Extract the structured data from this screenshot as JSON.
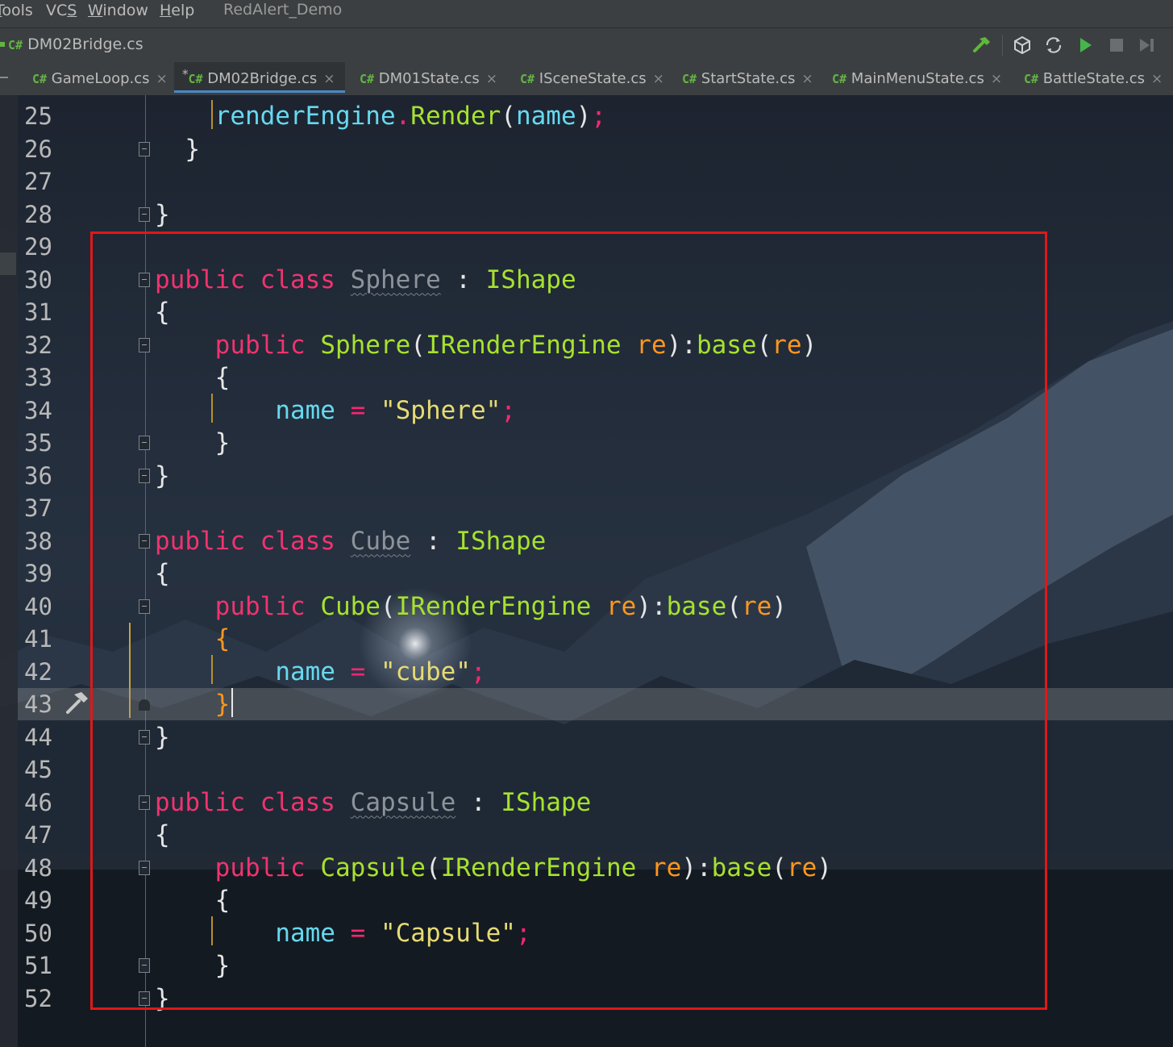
{
  "menubar": {
    "items": [
      {
        "label": "Tools",
        "underline": "T"
      },
      {
        "label": "VCS",
        "underline": "S"
      },
      {
        "label": "Window",
        "underline": "W"
      },
      {
        "label": "Help",
        "underline": "H"
      }
    ],
    "project": "RedAlert_Demo"
  },
  "navbar": {
    "breadcrumb_lang": "C#",
    "breadcrumb_file": "DM02Bridge.cs",
    "toolbar_icons": [
      "hammer-build-icon",
      "unity-icon",
      "refresh-sync-icon",
      "run-icon",
      "stop-icon",
      "step-icon"
    ]
  },
  "tabs": [
    {
      "lang": "C#",
      "label": "GameLoop.cs",
      "modified": false,
      "active": false
    },
    {
      "lang": "C#",
      "label": "DM02Bridge.cs",
      "modified": true,
      "active": true
    },
    {
      "lang": "C#",
      "label": "DM01State.cs",
      "modified": false,
      "active": false
    },
    {
      "lang": "C#",
      "label": "ISceneState.cs",
      "modified": false,
      "active": false
    },
    {
      "lang": "C#",
      "label": "StartState.cs",
      "modified": false,
      "active": false
    },
    {
      "lang": "C#",
      "label": "MainMenuState.cs",
      "modified": false,
      "active": false
    },
    {
      "lang": "C#",
      "label": "BattleState.cs",
      "modified": false,
      "active": false
    }
  ],
  "tab_close_glyph": "×",
  "tab_modified_glyph": "*",
  "editor": {
    "current_line": 43,
    "highlight_region": "lines 29-52",
    "colors": {
      "keyword": "#f0336f",
      "type": "#a6e22e",
      "field": "#66d9ef",
      "parameter": "#fd971f",
      "string": "#e6db74",
      "highlight_box": "#e01818"
    },
    "lines": [
      {
        "n": "25",
        "tokens": [
          [
            "    ",
            ""
          ],
          [
            "renderEngine",
            "fld"
          ],
          [
            ".",
            "op"
          ],
          [
            "Render",
            "ty"
          ],
          [
            "(",
            ""
          ],
          [
            "name",
            "fld"
          ],
          [
            ")",
            ""
          ],
          [
            ";",
            "op"
          ]
        ]
      },
      {
        "n": "26",
        "tokens": [
          [
            "  }",
            ""
          ]
        ]
      },
      {
        "n": "27",
        "tokens": []
      },
      {
        "n": "28",
        "tokens": [
          [
            "}",
            ""
          ]
        ]
      },
      {
        "n": "29",
        "tokens": []
      },
      {
        "n": "30",
        "tokens": [
          [
            "public",
            "kw"
          ],
          [
            " ",
            ""
          ],
          [
            "class",
            "kw"
          ],
          [
            " ",
            ""
          ],
          [
            "Sphere",
            "dim"
          ],
          [
            " : ",
            ""
          ],
          [
            "IShape",
            "ty"
          ]
        ]
      },
      {
        "n": "31",
        "tokens": [
          [
            "{",
            ""
          ]
        ]
      },
      {
        "n": "32",
        "tokens": [
          [
            "    ",
            ""
          ],
          [
            "public",
            "kw"
          ],
          [
            " ",
            ""
          ],
          [
            "Sphere",
            "ty"
          ],
          [
            "(",
            ""
          ],
          [
            "IRenderEngine",
            "ty"
          ],
          [
            " ",
            ""
          ],
          [
            "re",
            "prm"
          ],
          [
            "):",
            ""
          ],
          [
            "base",
            "ty"
          ],
          [
            "(",
            ""
          ],
          [
            "re",
            "prm"
          ],
          [
            ")",
            ""
          ]
        ]
      },
      {
        "n": "33",
        "tokens": [
          [
            "    {",
            ""
          ]
        ]
      },
      {
        "n": "34",
        "tokens": [
          [
            "        ",
            ""
          ],
          [
            "name",
            "fld"
          ],
          [
            " ",
            ""
          ],
          [
            "=",
            "op"
          ],
          [
            " ",
            ""
          ],
          [
            "\"Sphere\"",
            "str"
          ],
          [
            ";",
            "op"
          ]
        ]
      },
      {
        "n": "35",
        "tokens": [
          [
            "    }",
            ""
          ]
        ]
      },
      {
        "n": "36",
        "tokens": [
          [
            "}",
            ""
          ]
        ]
      },
      {
        "n": "37",
        "tokens": []
      },
      {
        "n": "38",
        "tokens": [
          [
            "public",
            "kw"
          ],
          [
            " ",
            ""
          ],
          [
            "class",
            "kw"
          ],
          [
            " ",
            ""
          ],
          [
            "Cube",
            "dim"
          ],
          [
            " : ",
            ""
          ],
          [
            "IShape",
            "ty"
          ]
        ]
      },
      {
        "n": "39",
        "tokens": [
          [
            "{",
            ""
          ]
        ]
      },
      {
        "n": "40",
        "tokens": [
          [
            "    ",
            ""
          ],
          [
            "public",
            "kw"
          ],
          [
            " ",
            ""
          ],
          [
            "Cube",
            "ty"
          ],
          [
            "(",
            ""
          ],
          [
            "IRenderEngine",
            "ty"
          ],
          [
            " ",
            ""
          ],
          [
            "re",
            "prm"
          ],
          [
            "):",
            ""
          ],
          [
            "base",
            "ty"
          ],
          [
            "(",
            ""
          ],
          [
            "re",
            "prm"
          ],
          [
            ")",
            ""
          ]
        ]
      },
      {
        "n": "41",
        "tokens": [
          [
            "    ",
            ""
          ],
          [
            "{",
            "brc"
          ]
        ]
      },
      {
        "n": "42",
        "tokens": [
          [
            "        ",
            ""
          ],
          [
            "name",
            "fld"
          ],
          [
            " ",
            ""
          ],
          [
            "=",
            "op"
          ],
          [
            " ",
            ""
          ],
          [
            "\"cube\"",
            "str"
          ],
          [
            ";",
            "op"
          ]
        ]
      },
      {
        "n": "43",
        "tokens": [
          [
            "    ",
            ""
          ],
          [
            "}",
            "brc"
          ]
        ]
      },
      {
        "n": "44",
        "tokens": [
          [
            "}",
            ""
          ]
        ]
      },
      {
        "n": "45",
        "tokens": []
      },
      {
        "n": "46",
        "tokens": [
          [
            "public",
            "kw"
          ],
          [
            " ",
            ""
          ],
          [
            "class",
            "kw"
          ],
          [
            " ",
            ""
          ],
          [
            "Capsule",
            "dim"
          ],
          [
            " : ",
            ""
          ],
          [
            "IShape",
            "ty"
          ]
        ]
      },
      {
        "n": "47",
        "tokens": [
          [
            "{",
            ""
          ]
        ]
      },
      {
        "n": "48",
        "tokens": [
          [
            "    ",
            ""
          ],
          [
            "public",
            "kw"
          ],
          [
            " ",
            ""
          ],
          [
            "Capsule",
            "ty"
          ],
          [
            "(",
            ""
          ],
          [
            "IRenderEngine",
            "ty"
          ],
          [
            " ",
            ""
          ],
          [
            "re",
            "prm"
          ],
          [
            "):",
            ""
          ],
          [
            "base",
            "ty"
          ],
          [
            "(",
            ""
          ],
          [
            "re",
            "prm"
          ],
          [
            ")",
            ""
          ]
        ]
      },
      {
        "n": "49",
        "tokens": [
          [
            "    {",
            ""
          ]
        ]
      },
      {
        "n": "50",
        "tokens": [
          [
            "        ",
            ""
          ],
          [
            "name",
            "fld"
          ],
          [
            " ",
            ""
          ],
          [
            "=",
            "op"
          ],
          [
            " ",
            ""
          ],
          [
            "\"Capsule\"",
            "str"
          ],
          [
            ";",
            "op"
          ]
        ]
      },
      {
        "n": "51",
        "tokens": [
          [
            "    }",
            ""
          ]
        ]
      },
      {
        "n": "52",
        "tokens": [
          [
            "}",
            ""
          ]
        ]
      }
    ]
  }
}
